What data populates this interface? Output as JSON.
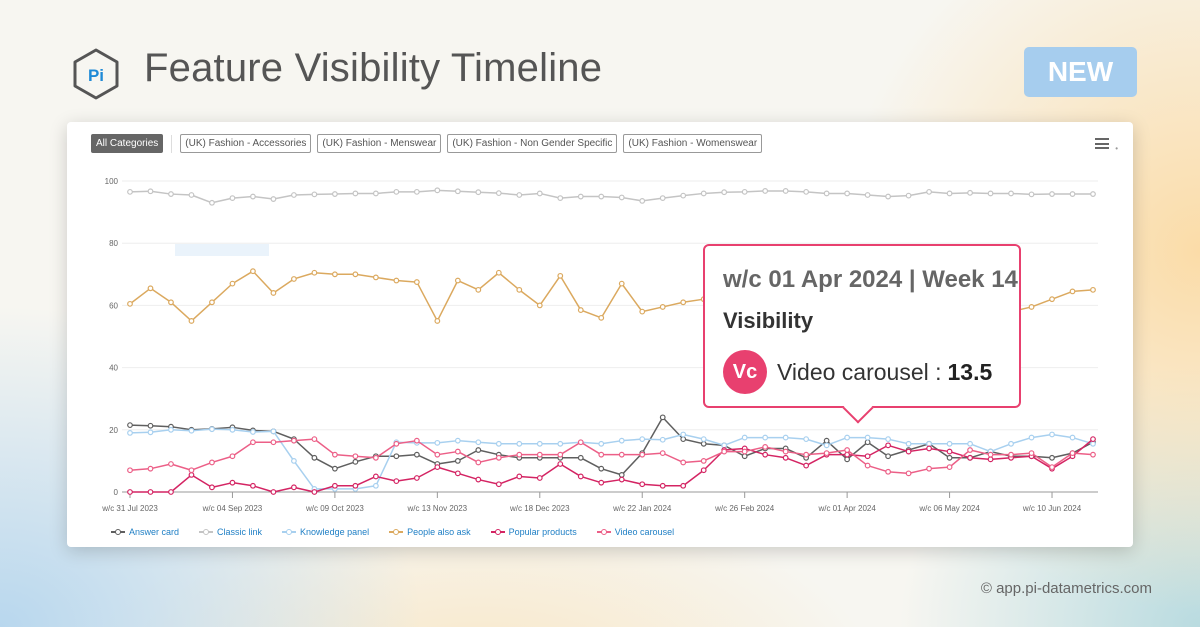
{
  "header": {
    "logo_text": "Pi",
    "title": "Feature Visibility Timeline",
    "badge": "NEW"
  },
  "filters": [
    {
      "label": "All Categories",
      "active": true
    },
    {
      "label": "(UK) Fashion - Accessories",
      "active": false
    },
    {
      "label": "(UK) Fashion - Menswear",
      "active": false
    },
    {
      "label": "(UK) Fashion - Non Gender Specific",
      "active": false
    },
    {
      "label": "(UK) Fashion - Womenswear",
      "active": false
    }
  ],
  "tooltip": {
    "heading": "w/c 01 Apr 2024 | Week 14",
    "metric": "Visibility",
    "badge": "Vc",
    "series_label": "Video carousel :",
    "value": "13.5",
    "week_index": 35
  },
  "footer": {
    "copyright": "© app.pi-datametrics.com"
  },
  "chart_data": {
    "type": "line",
    "title": "Feature Visibility Timeline",
    "xlabel": "",
    "ylabel": "Visibility",
    "ylim": [
      0,
      100
    ],
    "yticks": [
      0,
      20,
      40,
      60,
      80,
      100
    ],
    "grid": true,
    "legend_position": "bottom-left",
    "x_start": "w/c 31 Jul 2023",
    "x_count": 48,
    "x_tick_labels": [
      {
        "index": 0,
        "label": "w/c 31 Jul 2023"
      },
      {
        "index": 5,
        "label": "w/c 04 Sep 2023"
      },
      {
        "index": 10,
        "label": "w/c 09 Oct 2023"
      },
      {
        "index": 15,
        "label": "w/c 13 Nov 2023"
      },
      {
        "index": 20,
        "label": "w/c 18 Dec 2023"
      },
      {
        "index": 25,
        "label": "w/c 22 Jan 2024"
      },
      {
        "index": 30,
        "label": "w/c 26 Feb 2024"
      },
      {
        "index": 35,
        "label": "w/c 01 Apr 2024"
      },
      {
        "index": 40,
        "label": "w/c 06 May 2024"
      },
      {
        "index": 45,
        "label": "w/c 10 Jun 2024"
      }
    ],
    "series": [
      {
        "name": "Answer card",
        "color": "#5f5f5f",
        "values": [
          21.5,
          21.3,
          21,
          20,
          20.3,
          20.8,
          19.8,
          19.5,
          17,
          11,
          7.5,
          9.7,
          11.5,
          11.5,
          12,
          9,
          10,
          13.5,
          12,
          11,
          11,
          11,
          11,
          7.5,
          5.5,
          12.5,
          24,
          17,
          15.5,
          15,
          11.5,
          14,
          14,
          11,
          16.5,
          10.5,
          16,
          11.5,
          13.5,
          15.5,
          11,
          11,
          13,
          11.5,
          11.5,
          11,
          12.5,
          16
        ]
      },
      {
        "name": "Classic link",
        "color": "#c4c4c4",
        "values": [
          96.5,
          96.7,
          95.8,
          95.5,
          93,
          94.5,
          95,
          94.2,
          95.5,
          95.7,
          95.8,
          96,
          96,
          96.5,
          96.5,
          97,
          96.7,
          96.4,
          96.1,
          95.5,
          96,
          94.5,
          95,
          95,
          94.7,
          93.6,
          94.5,
          95.3,
          96,
          96.4,
          96.5,
          96.8,
          96.8,
          96.5,
          96,
          96,
          95.5,
          95,
          95.3,
          96.5,
          96,
          96.2,
          96,
          96,
          95.7,
          95.8,
          95.8,
          95.8
        ]
      },
      {
        "name": "Knowledge panel",
        "color": "#a8d0ef",
        "values": [
          19,
          19.2,
          20,
          19.7,
          20.2,
          20,
          19.3,
          19.5,
          10,
          1,
          1,
          1,
          2,
          16,
          15.8,
          15.8,
          16.5,
          16,
          15.5,
          15.5,
          15.5,
          15.5,
          16,
          15.5,
          16.5,
          17,
          16.8,
          18.5,
          17,
          15,
          17.5,
          17.5,
          17.5,
          17,
          15,
          17.5,
          17.5,
          17,
          15.5,
          15.5,
          15.5,
          15.5,
          13,
          15.5,
          17.5,
          18.5,
          17.5,
          15.5
        ]
      },
      {
        "name": "People also ask",
        "color": "#dba95f",
        "values": [
          60.5,
          65.5,
          61,
          55,
          61,
          67,
          71,
          64,
          68.5,
          70.5,
          70,
          70,
          69,
          68,
          67.5,
          55,
          68,
          65,
          70.5,
          65,
          60,
          69.5,
          58.5,
          56,
          67,
          58,
          59.5,
          61,
          62,
          63,
          62,
          61,
          60,
          61.5,
          62,
          61,
          60,
          61,
          62,
          60,
          59,
          58.5,
          58,
          58,
          59.5,
          62,
          64.5,
          65
        ]
      },
      {
        "name": "Popular products",
        "color": "#d42463",
        "values": [
          0,
          0,
          0,
          5.5,
          1.5,
          3,
          2,
          0,
          1.5,
          0,
          2,
          2,
          5,
          3.5,
          4.5,
          8,
          6,
          4,
          2.5,
          5,
          4.5,
          9,
          5,
          3,
          4,
          2.5,
          2,
          2,
          7,
          13.5,
          14,
          12,
          11,
          8.5,
          12,
          12,
          11.5,
          15,
          13,
          14,
          13,
          11,
          10.5,
          11,
          11.5,
          7.5,
          11.5,
          17
        ]
      },
      {
        "name": "Video carousel",
        "color": "#ec5f87",
        "values": [
          7,
          7.5,
          9,
          7,
          9.5,
          11.5,
          16,
          16,
          16.5,
          17,
          12,
          11.5,
          11,
          15.5,
          16.5,
          12,
          13,
          9.5,
          11,
          12,
          12,
          12,
          16,
          12,
          12,
          12,
          12.5,
          9.5,
          10,
          13,
          13,
          14.5,
          13,
          12,
          12.5,
          13.5,
          8.5,
          6.5,
          6,
          7.5,
          8,
          13.5,
          12,
          12,
          12.5,
          8,
          12.5,
          12
        ]
      }
    ]
  },
  "menu": {
    "icon": "hamburger-menu-icon"
  }
}
